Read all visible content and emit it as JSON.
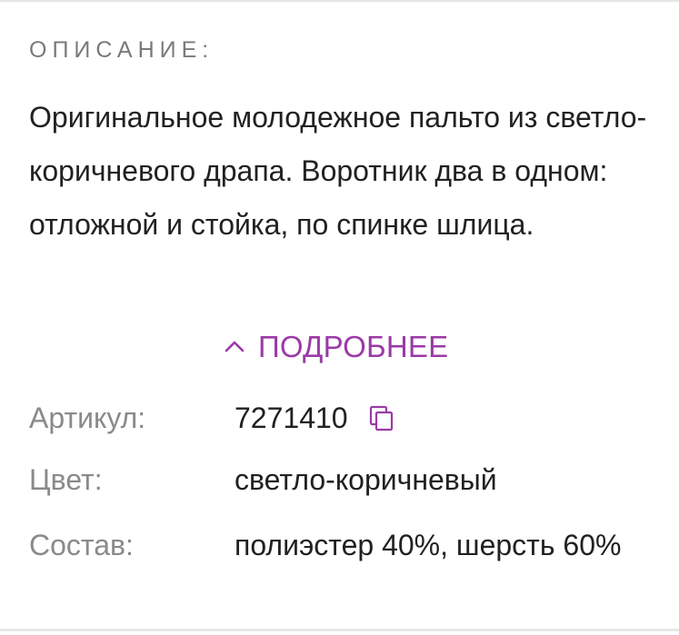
{
  "description_section": {
    "title": "ОПИСАНИЕ:",
    "text": "Оригинальное молодежное пальто из светло-коричневого драпа. Воротник два в одном: отложной и стойка, по спинке шлица.",
    "more_label": "ПОДРОБНЕЕ",
    "more_icon": "chevron-up-icon",
    "accent_color": "#9b3aa7"
  },
  "specs": {
    "article": {
      "label": "Артикул:",
      "value": "7271410",
      "icon": "copy-icon"
    },
    "color": {
      "label": "Цвет:",
      "value": "светло-коричневый"
    },
    "composition": {
      "label": "Состав:",
      "value": "полиэстер 40%, шерсть 60%"
    }
  }
}
